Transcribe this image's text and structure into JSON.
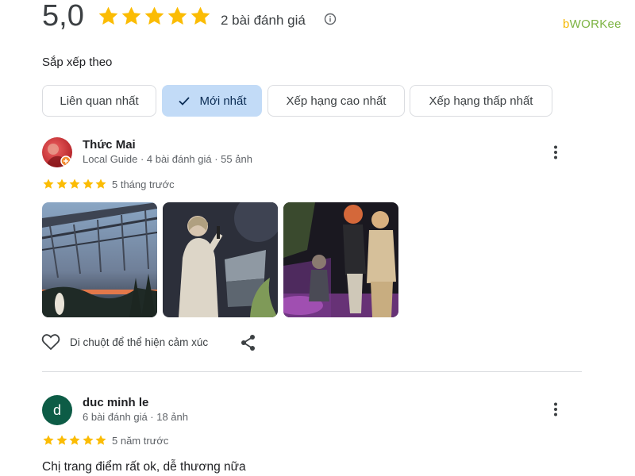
{
  "header": {
    "rating": "5,0",
    "stars": 5,
    "review_count": "2 bài đánh giá",
    "brand_prefix": "b",
    "brand_main": "WORKee"
  },
  "sort": {
    "label": "Sắp xếp theo",
    "options": [
      {
        "label": "Liên quan nhất",
        "selected": false
      },
      {
        "label": "Mới nhất",
        "selected": true
      },
      {
        "label": "Xếp hạng cao nhất",
        "selected": false
      },
      {
        "label": "Xếp hạng thấp nhất",
        "selected": false
      }
    ]
  },
  "reviews": [
    {
      "name": "Thức Mai",
      "meta": "Local Guide · 4 bài đánh giá · 55 ảnh",
      "rating": 5,
      "time": "5 tháng trước",
      "photos": 3,
      "like_text": "Di chuột để thể hiện cảm xúc"
    },
    {
      "name": "duc minh le",
      "avatar_letter": "d",
      "meta": "6 bài đánh giá · 18 ảnh",
      "rating": 5,
      "time": "5 năm trước",
      "text": "Chị trang điểm rất ok, dễ thương nữa"
    }
  ],
  "colors": {
    "star": "#fbbc04",
    "chip_selected": "#c2dbf7",
    "avatar2_bg": "#0d5c46"
  }
}
